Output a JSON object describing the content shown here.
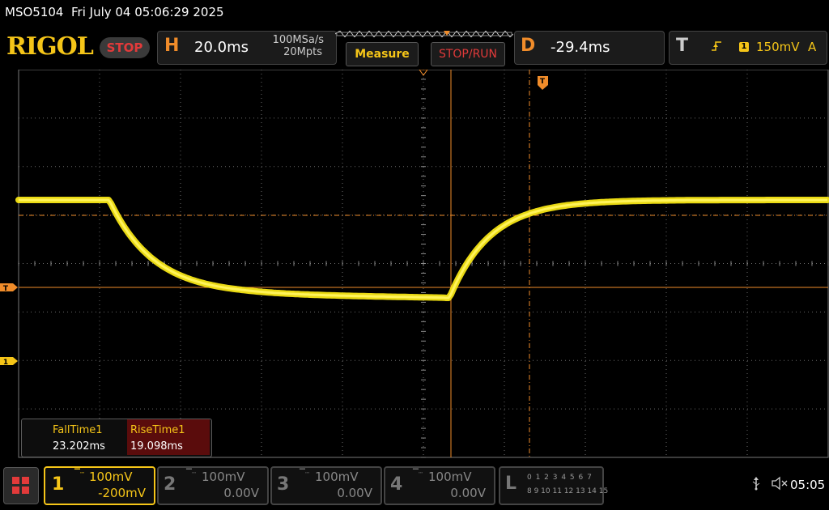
{
  "status": {
    "model": "MSO5104",
    "datetime": "Fri July 04 05:06:29 2025"
  },
  "header": {
    "brand": "RIGOL",
    "run_state": "STOP",
    "horizontal": {
      "key": "H",
      "time_base": "20.0ms",
      "sample_rate": "100MSa/s",
      "memory_depth": "20Mpts"
    },
    "measure_button": "Measure",
    "stop_run_button": "STOP/RUN",
    "delay": {
      "key": "D",
      "value": "-29.4ms"
    },
    "trigger": {
      "key": "T",
      "edge_icon": "rising-edge-icon",
      "source": "1",
      "level": "150mV",
      "mode": "A"
    }
  },
  "screen": {
    "trigger_marker": "T",
    "channel_marker": "1",
    "cursor_marker_icon": "trigger-position-icon"
  },
  "measurements": [
    {
      "label": "FallTime1",
      "value": "23.202ms"
    },
    {
      "label": "RiseTime1",
      "value": "19.098ms"
    }
  ],
  "channels": [
    {
      "num": "1",
      "coupling_icon": "dc-coupling-icon",
      "scale": "100mV",
      "offset": "-200mV",
      "active": true
    },
    {
      "num": "2",
      "coupling_icon": "dc-coupling-icon",
      "scale": "100mV",
      "offset": "0.00V",
      "active": false
    },
    {
      "num": "3",
      "coupling_icon": "dc-coupling-icon",
      "scale": "100mV",
      "offset": "0.00V",
      "active": false
    },
    {
      "num": "4",
      "coupling_icon": "dc-coupling-icon",
      "scale": "100mV",
      "offset": "0.00V",
      "active": false
    }
  ],
  "logic": {
    "key": "L",
    "row1": "0 1 2 3  4 5 6 7",
    "row2": "8 9 10 11 12 13 14 15"
  },
  "system": {
    "usb_icon": "usb-icon",
    "speaker_icon": "speaker-muted-icon",
    "time": "05:05"
  },
  "colors": {
    "ch1": "#f5c518",
    "accent": "#f08c2a",
    "stop": "#e23a3a"
  }
}
